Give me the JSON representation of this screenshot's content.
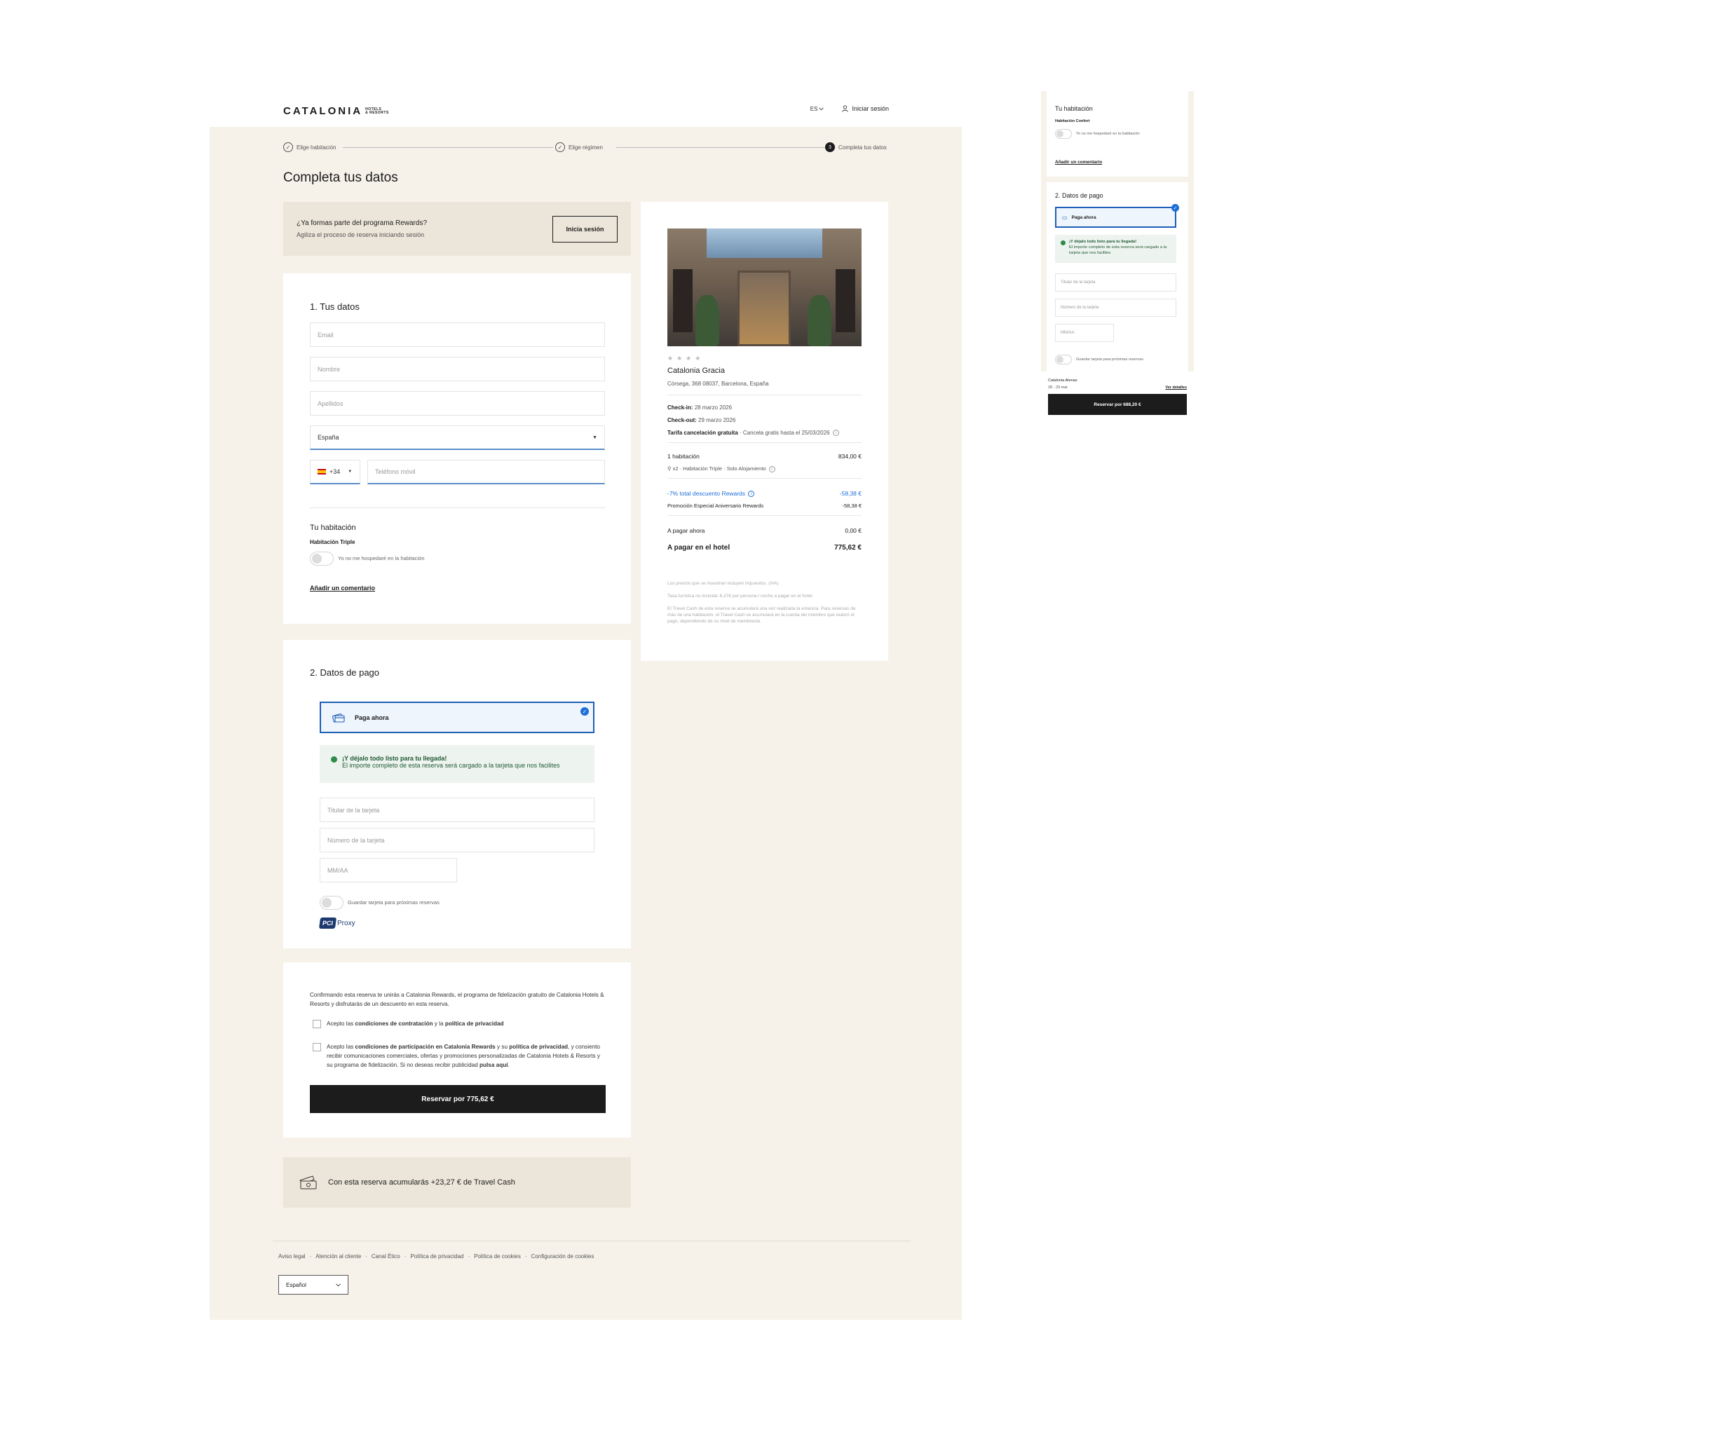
{
  "header": {
    "logo_main": "CATALONIA",
    "logo_sub_1": "HOTELS",
    "logo_sub_2": "& RESORTS",
    "language": "ES",
    "login": "Iniciar sesión"
  },
  "stepper": {
    "step1": "Elige habitación",
    "step2": "Elige régimen",
    "step3_number": "3",
    "step3": "Completa tus datos"
  },
  "page_title": "Completa tus datos",
  "rewards": {
    "title": "¿Ya formas parte del programa Rewards?",
    "subtitle": "Agiliza el proceso de reserva iniciando sesión",
    "button": "Inicia sesión"
  },
  "section1": {
    "title": "1. Tus datos",
    "email_placeholder": "Email",
    "name_placeholder": "Nombre",
    "surname_placeholder": "Apellidos",
    "country_value": "España",
    "phone_prefix": "+34",
    "phone_placeholder": "Teléfono móvil",
    "room_title": "Tu habitación",
    "room_type": "Habitación Triple",
    "not_staying": "Yo no me hospedaré en la habitación",
    "add_comment": "Añadir un comentario"
  },
  "section2": {
    "title": "2. Datos de pago",
    "pay_now": "Paga ahora",
    "notice_title": "¡Y déjalo todo listo para tu llegada!",
    "notice_text": "El importe completo de esta reserva será cargado a la tarjeta que nos facilites",
    "card_holder": "Titular de la tarjeta",
    "card_number": "Número de la tarjeta",
    "expiry": "MM/AA",
    "save_card": "Guardar tarjeta para próximas reservas",
    "pci_badge": "PCI",
    "pci_text": "Proxy"
  },
  "consent": {
    "intro": "Confirmando esta reserva te unirás a Catalonia Rewards, el programa de fidelización gratuito de Catalonia Hotels & Resorts y disfrutarás de un descuento en esta reserva.",
    "check1_a": "Acepto las ",
    "check1_b": "condiciones de contratación",
    "check1_c": " y la ",
    "check1_d": "política de privacidad",
    "check2_a": "Acepto las ",
    "check2_b": "condiciones de participación en Catalonia Rewards",
    "check2_c": " y su ",
    "check2_d": "política de privacidad",
    "check2_e": ", y consiento recibir comunicaciones comerciales, ofertas y promociones personalizadas de Catalonia Hotels & Resorts y su programa de fidelización. Si no deseas recibir publicidad ",
    "check2_f": "pulsa aquí",
    "check2_g": ".",
    "button": "Reservar por 775,62 €"
  },
  "travel_cash": "Con esta reserva acumularás +23,27 € de Travel Cash",
  "footer": {
    "links": [
      "Aviso legal",
      "Atención al cliente",
      "Canal Ético",
      "Política de privacidad",
      "Política de cookies",
      "Configuración de cookies"
    ],
    "language": "Español"
  },
  "summary": {
    "stars": "★★★★",
    "hotel_name": "Catalonia Gracia",
    "address": "Còrsega, 368 08037, Barcelona, España",
    "checkin_label": "Check-in:",
    "checkin_value": "28 marzo 2026",
    "checkout_label": "Check-out:",
    "checkout_value": "29 marzo 2026",
    "rate_label": "Tarifa cancelación gratuita",
    "rate_value": " · Cancela gratis hasta el 25/03/2026",
    "rooms_label": "1 habitación",
    "rooms_price": "834,00 €",
    "room_detail": "x2 · Habitación Triple · Solo Alojamiento",
    "discount_label": "-7% total descuento Rewards",
    "discount_value": "-58,38 €",
    "promo_label": "Promoción Especial Aniversario Rewards",
    "promo_value": "-58,38 €",
    "pay_now_label": "A pagar ahora",
    "pay_now_value": "0,00 €",
    "pay_hotel_label": "A pagar en el hotel",
    "pay_hotel_value": "775,62 €",
    "fine1": "Los precios que se muestran incluyen impuestos. (IVA)",
    "fine2": "Tasa turística no incluida: 6,27€ por persona / noche a pagar en el hotel.",
    "fine3": "El Travel Cash de esta reserva se acumulará una vez realizada la estancia. Para reservas de más de una habitación, el Travel Cash se acumulará en la cuenta del miembro que realizó el pago, dependiendo de su nivel de membresía."
  },
  "mobile": {
    "room_title": "Tu habitación",
    "room_type": "Habitación Confort",
    "not_staying": "Yo no me hospedaré en la habitación",
    "add_comment": "Añadir un comentario",
    "pay_title": "2. Datos de pago",
    "pay_now": "Paga ahora",
    "notice_title": "¡Y déjalo todo listo para tu llegada!",
    "notice_text": "El importe completo de esta reserva será cargado a la tarjeta que nos facilites",
    "card_holder": "Titular de la tarjeta",
    "card_number": "Número de la tarjeta",
    "expiry": "MM/AA",
    "save_card": "Guardar tarjeta para próximas reservas",
    "hotel": "Catalonia Atenas",
    "dates": "28 - 29 mar",
    "details": "Ver detalles",
    "button": "Reservar por 688,20 €"
  }
}
